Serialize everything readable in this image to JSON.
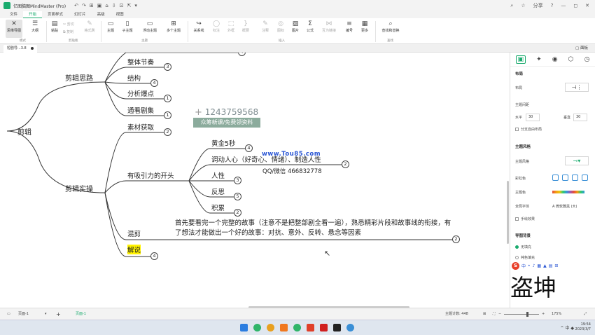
{
  "app": {
    "title": "亿图脑图MindMaster (Pro)",
    "quick_access": [
      "↶",
      "↷",
      "⊞",
      "▣",
      "⌂",
      "⇩",
      "⊡",
      "⇱",
      "▾"
    ],
    "titlebar_right": [
      "⌕",
      "☆",
      "分享",
      "?",
      "—",
      "◻",
      "✕"
    ]
  },
  "menu": {
    "items": [
      "文件",
      "开始",
      "页面样式",
      "幻灯片",
      "高级",
      "视图"
    ],
    "active_index": 1,
    "right": [
      "⋯",
      "⋯",
      "⋯"
    ]
  },
  "ribbon": {
    "mode": {
      "icon": "✕",
      "label": "思维导图"
    },
    "outline": {
      "icon": "☰",
      "label": "大纲"
    },
    "paste": {
      "icon": "▤",
      "label": "粘贴"
    },
    "cut": "✂ 剪切",
    "copy": "⧉ 复制",
    "format_painter": {
      "icon": "✎",
      "label": "格式刷"
    },
    "topic": {
      "icon": "▭",
      "label": "主题"
    },
    "subtopic": {
      "icon": "▯",
      "label": "子主题"
    },
    "floating_topic": {
      "icon": "▭",
      "label": "浮动主题"
    },
    "multi_topic": {
      "icon": "⊞",
      "label": "多个主题"
    },
    "relation": {
      "icon": "↪",
      "label": "关系线"
    },
    "callout": {
      "icon": "◯",
      "label": "标注"
    },
    "boundary": {
      "icon": "⬚",
      "label": "外框"
    },
    "summary": {
      "icon": "}",
      "label": "概要"
    },
    "comment": {
      "icon": "✎",
      "label": "注释"
    },
    "mark": {
      "icon": "◎",
      "label": "图标"
    },
    "image": {
      "icon": "▨",
      "label": "图片"
    },
    "formula": {
      "icon": "Σ",
      "label": "公式"
    },
    "cross": {
      "icon": "⋈",
      "label": "互为链接"
    },
    "number": {
      "icon": "≡",
      "label": "编号"
    },
    "more": {
      "icon": "▦",
      "label": "更多"
    },
    "find": {
      "icon": "⌕",
      "label": "查找和替换"
    },
    "groups": {
      "mode": "模式",
      "clipboard": "剪贴板",
      "topic": "主题",
      "insert": "插入",
      "find": "查找"
    }
  },
  "doc_tab": {
    "label": "短剧导...3.8"
  },
  "theme_toggle": "▢ 面板",
  "mindmap": {
    "root": "剪辑",
    "branch1": "剪辑思路",
    "b1_children": [
      {
        "label": "整体节奏",
        "badge": "3"
      },
      {
        "label": "结构",
        "badge": "4"
      },
      {
        "label": "分析爆点",
        "badge": "1"
      },
      {
        "label": "通看剧集",
        "badge": "1"
      }
    ],
    "top_cut_badge": "4",
    "branch2": "剪辑实操",
    "b2_material": {
      "label": "素材获取",
      "badge": "2"
    },
    "b2_opening": "有吸引力的开头",
    "opening_children": [
      {
        "label": "黄金5秒",
        "badge": "4"
      },
      {
        "label": "调动人心（好奇心、情绪）、制造人性",
        "badge": "2"
      },
      {
        "label": "人性",
        "badge": "3"
      },
      {
        "label": "反思",
        "badge": "5"
      },
      {
        "label": "积累",
        "badge": "2"
      }
    ],
    "b2_mix": {
      "label": "混剪",
      "badge": "2"
    },
    "mix_text": "首先要看完一个完整的故事（注意不是把整部剧全看一遍），熟悉精彩片段和故事线的衔接，有了想法才能做出一个好的故事：对抗、意外、反转、悬念等因素",
    "b2_narrate": {
      "label": "解说",
      "badge": "4"
    }
  },
  "watermarks": {
    "phone": "1243759568",
    "banner": "众筹新课/免费领资料",
    "site": "www.Tou85.com",
    "qq": "QQ/微信 466832778",
    "big": "盗坤"
  },
  "right_panel": {
    "tabs": [
      "▣",
      "✦",
      "◉",
      "⬡",
      "◷"
    ],
    "layout_title": "布局",
    "layout_label": "布局",
    "spacing_title": "主题间距",
    "horizontal_label": "水平",
    "horizontal_value": "30",
    "vertical_label": "垂直",
    "vertical_value": "30",
    "branch_free": "分支自由布局",
    "style_title": "主题风格",
    "theme_label": "主题风格",
    "rainbow_label": "彩虹色",
    "theme_color_label": "主题色",
    "font_label": "全局字体",
    "font_value": "A 微软雅黑 (大)",
    "hand_drawn": "手绘效果",
    "bg_title": "导图背景",
    "bg_none": "无填充",
    "bg_solid": "纯色填充",
    "ime": [
      "中",
      "•",
      "♪",
      "▦",
      "▲",
      "▤",
      "⊞"
    ]
  },
  "status": {
    "page_label": "页面-1",
    "add": "+",
    "page_tab": "页面-1",
    "topic_count": "主题计数: 448",
    "zoom": "175%"
  },
  "taskbar": {
    "time": "19:54",
    "date": "2023/3/7",
    "sys": "^ 中 ◆"
  }
}
